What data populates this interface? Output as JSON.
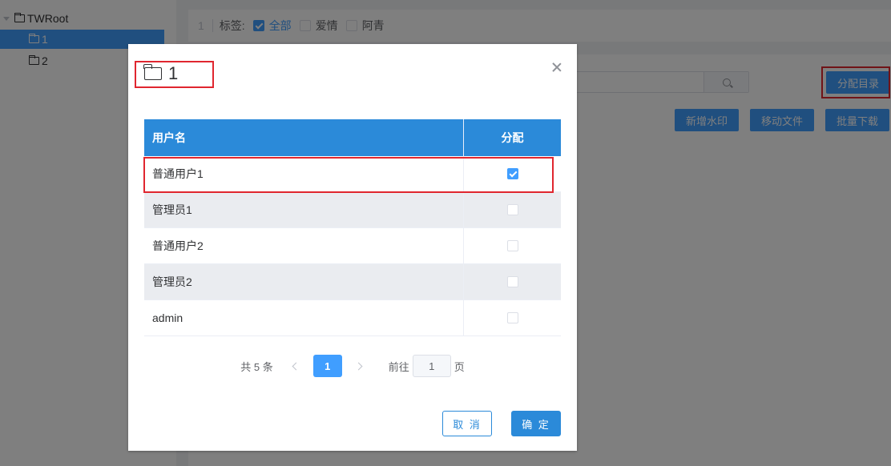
{
  "tree": {
    "root_label": "TWRoot",
    "items": [
      {
        "label": "1",
        "selected": true
      },
      {
        "label": "2",
        "selected": false
      }
    ]
  },
  "tagbar": {
    "crumb": "1",
    "label": "标签:",
    "tags": [
      {
        "label": "全部",
        "checked": true
      },
      {
        "label": "爱情",
        "checked": false
      },
      {
        "label": "阿青",
        "checked": false
      }
    ]
  },
  "toolbar": {
    "assign_label": "分配目录",
    "watermark_label": "新增水印",
    "move_label": "移动文件",
    "download_label": "批量下载"
  },
  "dialog": {
    "title": "1",
    "columns": {
      "name": "用户名",
      "assign": "分配"
    },
    "rows": [
      {
        "name": "普通用户1",
        "assigned": true
      },
      {
        "name": "管理员1",
        "assigned": false
      },
      {
        "name": "普通用户2",
        "assigned": false
      },
      {
        "name": "管理员2",
        "assigned": false
      },
      {
        "name": "admin",
        "assigned": false
      }
    ],
    "pagination": {
      "total": "共 5 条",
      "current": "1",
      "goto_label": "前往",
      "goto_value": "1",
      "page_suffix": "页"
    },
    "cancel_label": "取 消",
    "ok_label": "确 定"
  },
  "colors": {
    "primary": "#409eff",
    "header": "#2b8ad9",
    "highlight": "#e0262f"
  }
}
